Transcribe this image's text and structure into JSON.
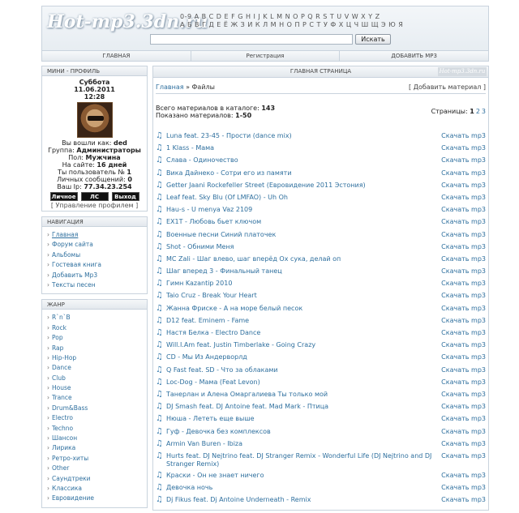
{
  "header": {
    "logo": "Hot-mp3.3dn.ru",
    "alphabet_row1": "0-9 A B C D E F G H I J K L M N O P Q R S T U V W X Y Z",
    "alphabet_row2": "А Б В Г Д Е Ё Ж З И К Л М Н О П Р С Т У Ф Х Ц Ч Ш Щ Э Ю Я",
    "search_placeholder": "",
    "search_button": "Искать"
  },
  "navbar": [
    "ГЛАВНАЯ",
    "Регистрация",
    "ДОБАВИТЬ MP3"
  ],
  "sidebar": {
    "profile": {
      "title": "МИНИ - ПРОФИЛЬ",
      "day": "Суббота",
      "date": "11.06.2011",
      "time": "12:28",
      "login_label": "Вы вошли как: ",
      "login_value": "ded",
      "group_label": "Группа: ",
      "group_value": "Администраторы",
      "sex_label": "Пол: ",
      "sex_value": "Мужчина",
      "site_label": "На сайте: ",
      "site_value": "16 дней",
      "user_no_label": "Ты пользователь № ",
      "user_no_value": "1",
      "messages_label": "Личных сообщений: ",
      "messages_value": "0",
      "ip_label": "Ваш Ip: ",
      "ip_value": "77.34.23.254",
      "btn_personal": "Личное",
      "btn_pm": "ЛС",
      "btn_exit": "Выход",
      "manage": "[ Управление профилем ]"
    },
    "navigation": {
      "title": "НАВИГАЦИЯ",
      "items": [
        "Главная",
        "Форум сайта",
        "Альбомы",
        "Гостевая книга",
        "Добавить Mp3",
        "Тексты песен"
      ]
    },
    "genres": {
      "title": "ЖАНР",
      "items": [
        "R`n`B",
        "Rock",
        "Pop",
        "Rap",
        "Hip-Hop",
        "Dance",
        "Club",
        "House",
        "Trance",
        "Drum&Bass",
        "Electro",
        "Techno",
        "Шансон",
        "Лирика",
        "Ретро-хиты",
        "Other",
        "Саундтреки",
        "Классика",
        "Евровидение"
      ]
    }
  },
  "main": {
    "title": "ГЛАВНАЯ СТРАНИЦА",
    "badge": "Hot-mp3.3dn.ru",
    "crumb_home": "Главная",
    "crumb_sep": " » ",
    "crumb_current": "Файлы",
    "add_material": "[ Добавить материал ]",
    "total_label": "Всего материалов в каталоге: ",
    "total_value": "143",
    "shown_label": "Показано материалов: ",
    "shown_value": "1-50",
    "pages_label": "Страницы: ",
    "pages_current": "1",
    "pages": [
      "2",
      "3"
    ],
    "download_label": "Скачать mp3",
    "tracks": [
      "Luna feat. 23-45 - Прости (dance mix)",
      "1 Klass - Мама",
      "Слава - Одиночество",
      "Вика Дайнеко - Сотри его из памяти",
      "Getter Jaani Rockefeller Street (Евровидение 2011 Эстония)",
      "Leaf feat. Sky Blu (Of LMFAO) - Uh Oh",
      "Hau-s - U menya Vaz 2109",
      "EX1T - Любовь бьет ключом",
      "Военные песни Синий платочек",
      "Shot - Обними Меня",
      "MC Zali - Шаг влево, шаг вперёд Ох сука, делай оп",
      "Шаг вперед 3 - Финальный танец",
      "Гимн Kazantip 2010",
      "Taio Cruz - Break Your Heart",
      "Жанна Фриске - А на море белый песок",
      "D12 feat. Eminem - Fame",
      "Настя Белка - Electro Dance",
      "Will.I.Am feat. Justin Timberlake - Going Crazy",
      "CD - Мы Из Андерворлд",
      "Q Fast feat. SD - Что за облаками",
      "Loc-Dog - Мама (Feat Levon)",
      "Танерлан и Алена Омаргалиева Ты только мой",
      "DJ Smash feat. DJ Antoine feat. Mad Mark - Птица",
      "Нюша - Лететь еще выше",
      "Гуф - Девочка без комплексов",
      "Armin Van Buren - Ibiza",
      "Hurts feat. DJ Nejtrino feat. DJ Stranger Remix - Wonderful Life (DJ Nejtrino and DJ Stranger Remix)",
      "Краски - Он не знает ничего",
      "Девочка ночь",
      "Dj Fikus feat. Dj Antoine Underneath - Remix"
    ]
  }
}
